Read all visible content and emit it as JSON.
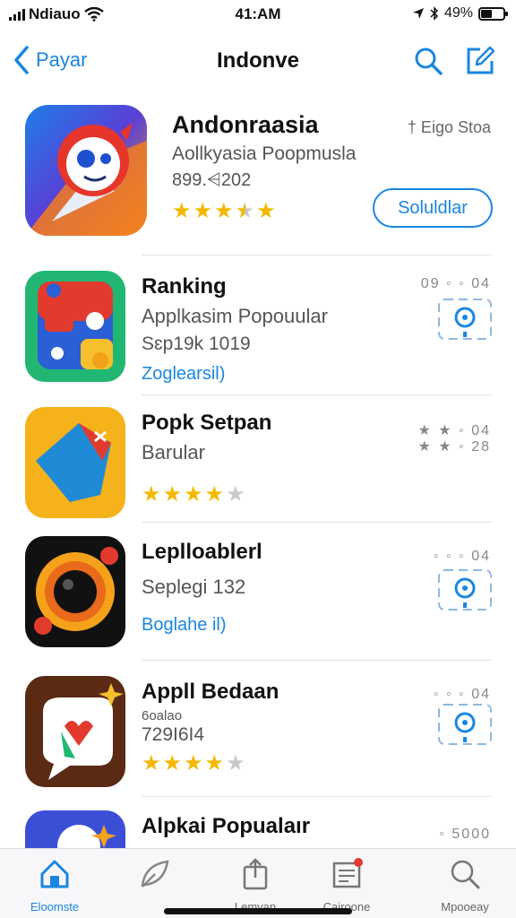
{
  "status_bar": {
    "carrier": "Ndiauo",
    "time": "41:AM",
    "battery": "49%",
    "battery_level": 0.49
  },
  "nav": {
    "back_label": "Payar",
    "title": "Indonve",
    "icons": [
      "search-icon",
      "compose-icon"
    ]
  },
  "featured": {
    "name": "Andonraasia",
    "subtitle": "Aollkyasia Poopmusla",
    "count": "899.⩤202",
    "meta": "† Eigo Stoa",
    "rating": 3.5,
    "get_label": "Soluldlar"
  },
  "list": [
    {
      "name": "Ranking",
      "line2": "Applkasim Popouular",
      "line3": "Sɛp19k 1019",
      "link": "Zoglearsil)",
      "meta": "09 ◦ ◦ 04"
    },
    {
      "name": "Popk Setpan",
      "line2": "Barular",
      "rating": 4,
      "meta": "★ ★ ◦ 04",
      "meta2": "★ ★ ◦ 28"
    },
    {
      "name": "Leplloablerl",
      "line2": "Seplegi 132",
      "link": "Boglahe il)",
      "meta": "◦ ◦ ◦ 04"
    },
    {
      "name": "Appll Bedaan",
      "line_small": "6oalao",
      "line4": "729I6I4",
      "rating": 4,
      "meta": "◦ ◦ ◦ 04"
    },
    {
      "name": "Alpkai Popualaır",
      "meta": "◦ 5000"
    }
  ],
  "tabbar": {
    "tabs": [
      {
        "label": "Eloomste",
        "icon": "home-icon"
      },
      {
        "label": "",
        "icon": "leaf-icon"
      },
      {
        "label": "Lemvan",
        "icon": "share-icon"
      },
      {
        "label": "Cairoone",
        "icon": "news-icon"
      },
      {
        "label": "Mpooeay",
        "icon": "search-icon"
      }
    ]
  },
  "colors": {
    "accent": "#1a86e0",
    "star": "#f5b800",
    "badge": "#e23b2e"
  }
}
